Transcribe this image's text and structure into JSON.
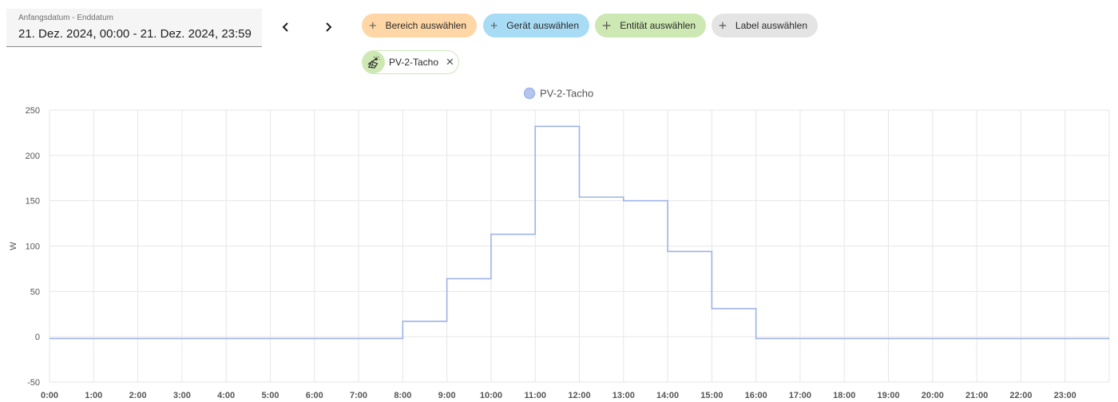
{
  "date_range": {
    "label": "Anfangsdatum - Enddatum",
    "value": "21. Dez. 2024, 00:00 - 21. Dez. 2024, 23:59"
  },
  "filters": {
    "area": "Bereich auswählen",
    "device": "Gerät auswählen",
    "entity": "Entität auswählen",
    "label": "Label auswählen"
  },
  "selected_entity": {
    "name": "PV-2-Tacho",
    "icon": "solar-power-icon"
  },
  "colors": {
    "area_chip": "#ffd7a6",
    "device_chip": "#a8dcf5",
    "entity_chip": "#cde8b2",
    "label_chip": "#e4e4e4",
    "series_line": "#9db4e8"
  },
  "chart_data": {
    "type": "line",
    "step": true,
    "ylabel": "W",
    "ylim": [
      -50,
      250
    ],
    "yticks": [
      -50,
      0,
      50,
      100,
      150,
      200,
      250
    ],
    "ytick_labels": [
      "-50",
      "0",
      "50",
      "100",
      "150",
      "200",
      "250"
    ],
    "xlim": [
      0,
      24
    ],
    "xticks": [
      0,
      1,
      2,
      3,
      4,
      5,
      6,
      7,
      8,
      9,
      10,
      11,
      12,
      13,
      14,
      15,
      16,
      17,
      18,
      19,
      20,
      21,
      22,
      23
    ],
    "xtick_labels": [
      "0:00",
      "1:00",
      "2:00",
      "3:00",
      "4:00",
      "5:00",
      "6:00",
      "7:00",
      "8:00",
      "9:00",
      "10:00",
      "11:00",
      "12:00",
      "13:00",
      "14:00",
      "15:00",
      "16:00",
      "17:00",
      "18:00",
      "19:00",
      "20:00",
      "21:00",
      "22:00",
      "23:00"
    ],
    "grid": true,
    "legend_position": "top-center",
    "series": [
      {
        "name": "PV-2-Tacho",
        "x": [
          0,
          8,
          9,
          10,
          11,
          12,
          13,
          14,
          15,
          16,
          24
        ],
        "y": [
          -2,
          17,
          64,
          113,
          232,
          154,
          150,
          94,
          31,
          -2,
          -2
        ]
      }
    ]
  }
}
